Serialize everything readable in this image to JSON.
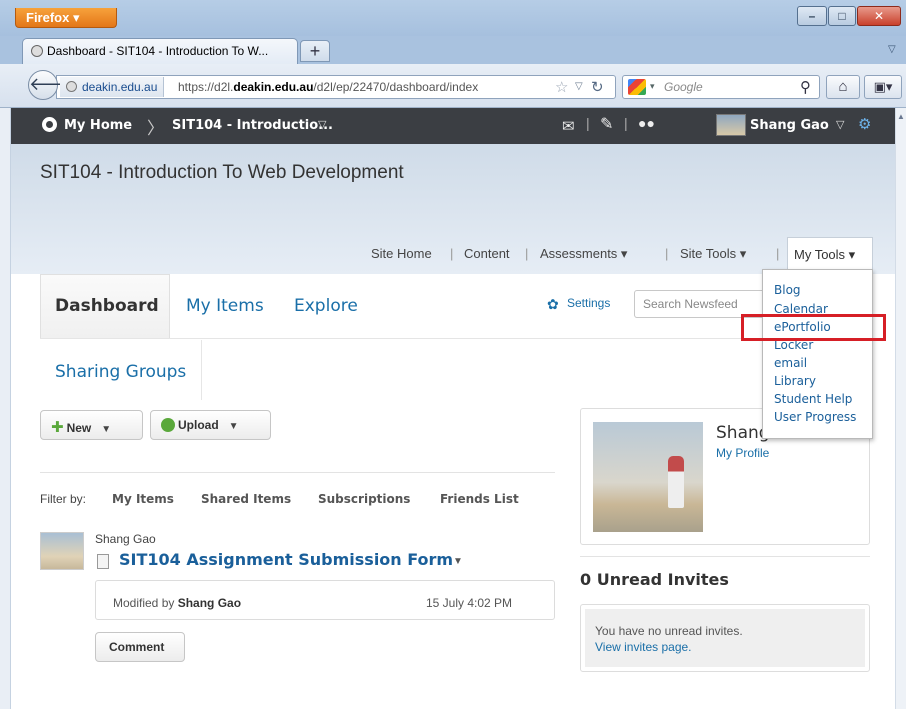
{
  "browser": {
    "app_button": "Firefox ▾",
    "tab_title": "Dashboard - SIT104 - Introduction To W...",
    "new_tab": "+",
    "url_site": "deakin.edu.au",
    "url_prefix": "https://d2l.",
    "url_host_bold": "deakin.edu.au",
    "url_path": "/d2l/ep/22470/dashboard/index",
    "search_placeholder": "Google"
  },
  "d2l_nav": {
    "home": "My Home",
    "separator": "〉",
    "course": "SIT104 - Introductio...",
    "user": "Shang Gao"
  },
  "course": {
    "title": "SIT104 - Introduction To Web Development",
    "nav": [
      "Site Home",
      "Content",
      "Assessments ▾",
      "Site Tools ▾",
      "My Tools ▾"
    ],
    "nav_sep": "|"
  },
  "tabs": {
    "dashboard": "Dashboard",
    "my_items": "My Items",
    "explore": "Explore",
    "sharing_groups": "Sharing Groups"
  },
  "settings_label": "Settings",
  "newsfeed_search_placeholder": "Search Newsfeed",
  "buttons": {
    "new": "New",
    "upload": "Upload",
    "comment": "Comment"
  },
  "filter": {
    "label": "Filter by:",
    "items": [
      "My Items",
      "Shared Items",
      "Subscriptions",
      "Friends List"
    ]
  },
  "post": {
    "author": "Shang Gao",
    "title": "SIT104 Assignment Submission Form",
    "modified_prefix": "Modified by",
    "modified_by": "Shang Gao",
    "date": "15 July 4:02 PM"
  },
  "profile": {
    "name": "Shang",
    "link": "My Profile"
  },
  "invites": {
    "title": "0 Unread Invites",
    "message": "You have no unread invites.",
    "link": "View invites page."
  },
  "tools_menu": {
    "items": [
      "Blog",
      "Calendar",
      "ePortfolio",
      "Locker",
      "email",
      "Library",
      "Student Help",
      "User Progress"
    ],
    "highlighted": "ePortfolio",
    "highlight_color": "#d61f26"
  }
}
